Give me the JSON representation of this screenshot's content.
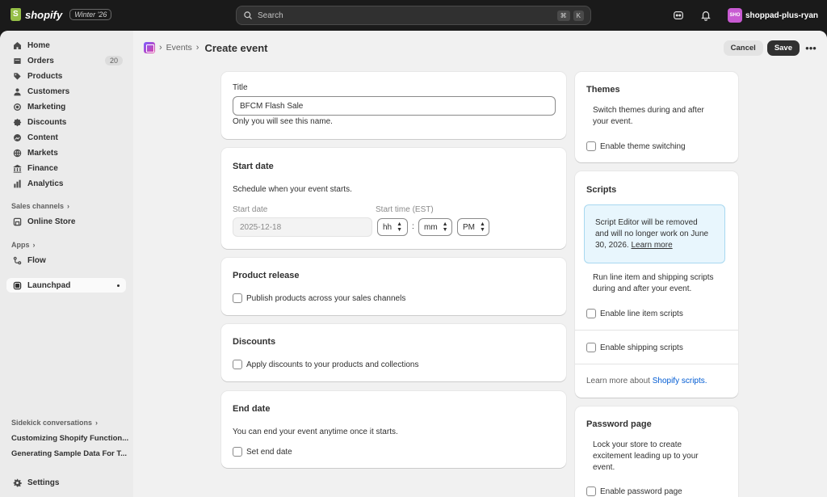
{
  "topbar": {
    "brand": "shopify",
    "edition": "Winter '26",
    "search_placeholder": "Search",
    "kbd_1": "⌘",
    "kbd_2": "K",
    "store_initials": "SHO",
    "store_name": "shoppad-plus-ryan"
  },
  "sidebar": {
    "items": [
      {
        "label": "Home",
        "icon": "home-icon"
      },
      {
        "label": "Orders",
        "icon": "orders-icon",
        "count": "20"
      },
      {
        "label": "Products",
        "icon": "tag-icon"
      },
      {
        "label": "Customers",
        "icon": "person-icon"
      },
      {
        "label": "Marketing",
        "icon": "target-icon"
      },
      {
        "label": "Discounts",
        "icon": "discount-icon"
      },
      {
        "label": "Content",
        "icon": "content-icon"
      },
      {
        "label": "Markets",
        "icon": "globe-icon"
      },
      {
        "label": "Finance",
        "icon": "bank-icon"
      },
      {
        "label": "Analytics",
        "icon": "chart-icon"
      }
    ],
    "sales_channels_label": "Sales channels",
    "online_store_label": "Online Store",
    "apps_label": "Apps",
    "flow_label": "Flow",
    "launchpad_label": "Launchpad",
    "sidekick_label": "Sidekick conversations",
    "sidekick_items": [
      "Customizing Shopify Function...",
      "Generating Sample Data For T..."
    ],
    "settings_label": "Settings"
  },
  "header": {
    "breadcrumb_link": "Events",
    "title": "Create event",
    "cancel_label": "Cancel",
    "save_label": "Save"
  },
  "title_card": {
    "label": "Title",
    "value": "BFCM Flash Sale",
    "help": "Only you will see this name."
  },
  "start_date_card": {
    "title": "Start date",
    "description": "Schedule when your event starts.",
    "date_label": "Start date",
    "date_placeholder": "2025-12-18",
    "time_label": "Start time (EST)",
    "hour": "hh",
    "colon": ":",
    "minute": "mm",
    "meridiem": "PM"
  },
  "product_release_card": {
    "title": "Product release",
    "checkbox_label": "Publish products across your sales channels"
  },
  "discounts_card": {
    "title": "Discounts",
    "checkbox_label": "Apply discounts to your products and collections"
  },
  "end_date_card": {
    "title": "End date",
    "description": "You can end your event anytime once it starts.",
    "checkbox_label": "Set end date"
  },
  "themes_card": {
    "title": "Themes",
    "description_1": "Switch themes during and after",
    "description_2": "your event.",
    "checkbox_label": "Enable theme switching"
  },
  "scripts_card": {
    "title": "Scripts",
    "notice_1": "Script Editor will be removed",
    "notice_2": "and will no longer work on June",
    "notice_3": "30, 2026.",
    "notice_link": "Learn more",
    "description_1": "Run line item and shipping scripts",
    "description_2": "during and after your event.",
    "line_item_label": "Enable line item scripts",
    "shipping_label": "Enable shipping scripts",
    "learn_prefix": "Learn more about",
    "learn_link": "Shopify scripts."
  },
  "password_card": {
    "title": "Password page",
    "description_1": "Lock your store to create",
    "description_2": "excitement leading up to your",
    "description_3": "event.",
    "checkbox_label": "Enable password page"
  },
  "colors": {
    "topbar": "#1a1a1a",
    "primary_button": "#303030",
    "link": "#005bd3",
    "notice_bg": "#e8f6fd",
    "avatar": "#c85ad2"
  }
}
